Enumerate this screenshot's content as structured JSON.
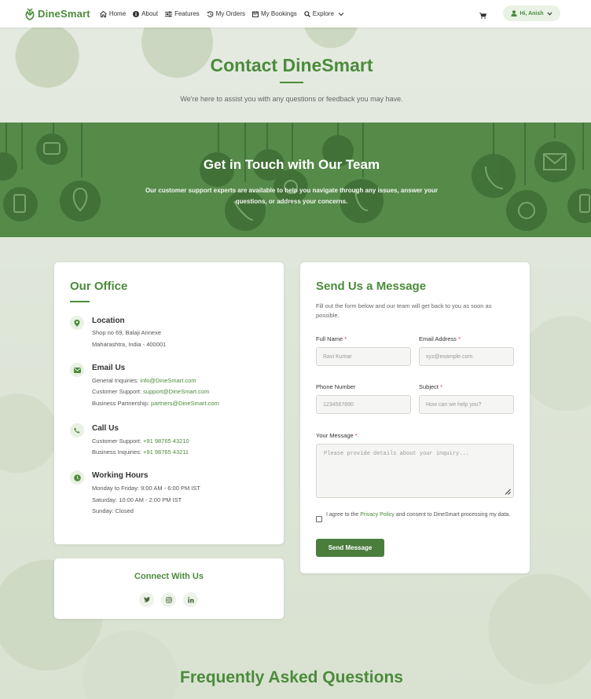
{
  "nav": {
    "brand": "DineSmart",
    "links": [
      {
        "label": "Home",
        "icon": "home-icon"
      },
      {
        "label": "About",
        "icon": "info-icon"
      },
      {
        "label": "Features",
        "icon": "sliders-icon"
      },
      {
        "label": "My Orders",
        "icon": "history-icon"
      },
      {
        "label": "My Bookings",
        "icon": "calendar-icon"
      },
      {
        "label": "Explore",
        "icon": "search-icon"
      }
    ],
    "user_label": "Hi, Anish"
  },
  "hero": {
    "title": "Contact DineSmart",
    "subtitle": "We're here to assist you with any questions or feedback you may have."
  },
  "band": {
    "title": "Get in Touch with Our Team",
    "text": "Our customer support experts are available to help you navigate through any issues, answer your questions, or address your concerns."
  },
  "office": {
    "title": "Our Office",
    "location": {
      "title": "Location",
      "line1": "Shop no 69, Balaji Annexe",
      "line2": "Maharashtra, India - 400001"
    },
    "email": {
      "title": "Email Us",
      "general_label": "General Inquiries: ",
      "general": "info@DineSmart.com",
      "support_label": "Customer Support: ",
      "support": "support@DineSmart.com",
      "partner_label": "Business Partnership: ",
      "partner": "partners@DineSmart.com"
    },
    "call": {
      "title": "Call Us",
      "support_label": "Customer Support: ",
      "support": "+91 98765 43210",
      "business_label": "Business Inquiries: ",
      "business": "+91 98765 43211"
    },
    "hours": {
      "title": "Working Hours",
      "line1": "Monday to Friday: 9:00 AM - 6:00 PM IST",
      "line2": "Saturday: 10:00 AM - 2:00 PM IST",
      "line3": "Sunday: Closed"
    }
  },
  "connect": {
    "title": "Connect With Us"
  },
  "form": {
    "title": "Send Us a Message",
    "intro": "Fill out the form below and our team will get back to you as soon as possible.",
    "name_label": "Full Name ",
    "name_placeholder": "Ravi Kumar",
    "email_label": "Email Address ",
    "email_placeholder": "xyz@example.com",
    "phone_label": "Phone Number",
    "phone_placeholder": "1234567890",
    "subject_label": "Subject ",
    "subject_placeholder": "How can we help you?",
    "message_label": "Your Message ",
    "message_placeholder": "Please provide details about your inquiry...",
    "required_mark": "*",
    "agree_prefix": "I agree to the ",
    "agree_link": "Privacy Policy",
    "agree_suffix": " and consent to DineSmart processing my data.",
    "submit": "Send Message"
  },
  "faq": {
    "title": "Frequently Asked Questions"
  },
  "colors": {
    "brand": "#4b8b3b",
    "band": "#558a49",
    "required": "#d33333"
  }
}
